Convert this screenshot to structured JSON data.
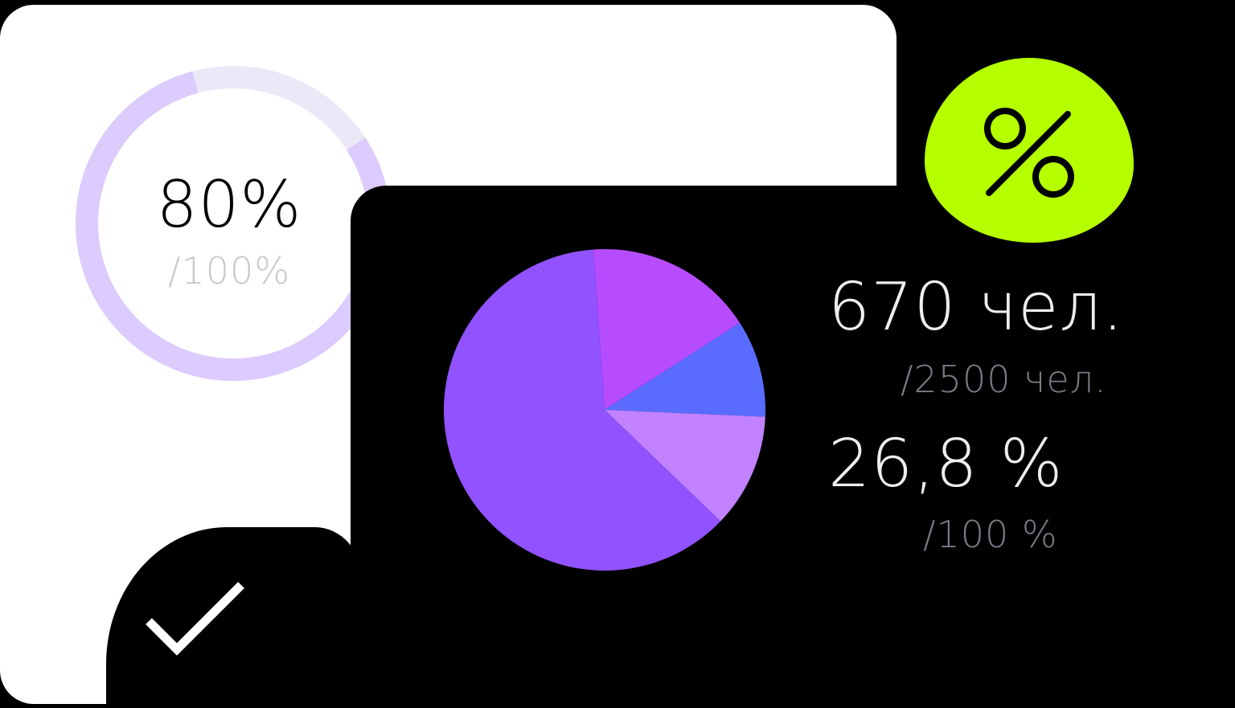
{
  "ring": {
    "value_label": "80%",
    "total_label": "/100%",
    "value_fraction": 0.8,
    "color_filled": "#dccbfd",
    "color_empty": "#ebe8f8"
  },
  "badge": {
    "icon": "percent-icon",
    "color": "#b6ff00"
  },
  "stats": {
    "people_value": "670 чел.",
    "people_total": "/2500 чел.",
    "share_value": "26,8 %",
    "share_total": "/100 %"
  },
  "check": {
    "icon": "checkmark-icon"
  },
  "chart_data": [
    {
      "type": "pie",
      "values": [
        80,
        20
      ],
      "colors": [
        "#dccbfd",
        "#ebe8f8"
      ],
      "center_label": "80%",
      "center_sublabel": "/100%"
    },
    {
      "type": "pie",
      "values": [
        17,
        9.8,
        11.5,
        61.7
      ],
      "colors": [
        "#b74cff",
        "#5a6cff",
        "#c282ff",
        "#9152ff"
      ]
    }
  ]
}
